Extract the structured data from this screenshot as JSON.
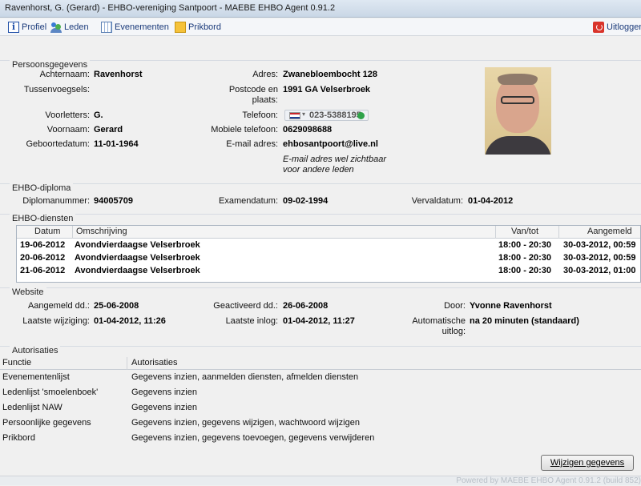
{
  "window": {
    "title": "Ravenhorst, G. (Gerard) - EHBO-vereniging Santpoort - MAEBE EHBO Agent 0.91.2"
  },
  "toolbar": {
    "profiel": "Profiel",
    "leden": "Leden",
    "evenementen": "Evenementen",
    "prikbord": "Prikbord",
    "uitloggen": "Uitloggen"
  },
  "persoon": {
    "legend": "Persoonsgegevens",
    "achternaam_label": "Achternaam:",
    "achternaam": "Ravenhorst",
    "tussenvoegsels_label": "Tussenvoegsels:",
    "tussenvoegsels": "",
    "voorletters_label": "Voorletters:",
    "voorletters": "G.",
    "voornaam_label": "Voornaam:",
    "voornaam": "Gerard",
    "geboortedatum_label": "Geboortedatum:",
    "geboortedatum": "11-01-1964",
    "adres_label": "Adres:",
    "adres": "Zwanebloembocht 128",
    "postcode_label_1": "Postcode en",
    "postcode_label_2": "plaats:",
    "postcode": "1991 GA Velserbroek",
    "telefoon_label": "Telefoon:",
    "telefoon": "023-5388195",
    "mobiel_label": "Mobiele telefoon:",
    "mobiel": "0629098688",
    "email_label": "E-mail adres:",
    "email": "ehbosantpoort@live.nl",
    "email_note_1": "E-mail adres wel zichtbaar",
    "email_note_2": "voor andere leden"
  },
  "diploma": {
    "legend": "EHBO-diploma",
    "nummer_label": "Diplomanummer:",
    "nummer": "94005709",
    "examen_label": "Examendatum:",
    "examen": "09-02-1994",
    "verval_label": "Vervaldatum:",
    "verval": "01-04-2012"
  },
  "diensten": {
    "legend": "EHBO-diensten",
    "columns": [
      "Datum",
      "Omschrijving",
      "Van/tot",
      "Aangemeld"
    ],
    "rows": [
      [
        "19-06-2012",
        "Avondvierdaagse Velserbroek",
        "18:00 - 20:30",
        "30-03-2012, 00:59"
      ],
      [
        "20-06-2012",
        "Avondvierdaagse Velserbroek",
        "18:00 - 20:30",
        "30-03-2012, 00:59"
      ],
      [
        "21-06-2012",
        "Avondvierdaagse Velserbroek",
        "18:00 - 20:30",
        "30-03-2012, 01:00"
      ]
    ]
  },
  "website": {
    "legend": "Website",
    "aangemeld_label": "Aangemeld dd.:",
    "aangemeld": "25-06-2008",
    "geactiveerd_label": "Geactiveerd dd.:",
    "geactiveerd": "26-06-2008",
    "door_label": "Door:",
    "door": "Yvonne Ravenhorst",
    "wijziging_label": "Laatste wijziging:",
    "wijziging": "01-04-2012, 11:26",
    "inlog_label": "Laatste inlog:",
    "inlog": "01-04-2012, 11:27",
    "uitlog_label_1": "Automatische",
    "uitlog_label_2": "uitlog:",
    "uitlog": "na 20 minuten (standaard)"
  },
  "autorisaties": {
    "legend": "Autorisaties",
    "columns": [
      "Functie",
      "Autorisaties"
    ],
    "rows": [
      [
        "Evenementenlijst",
        "Gegevens inzien, aanmelden diensten, afmelden diensten"
      ],
      [
        "Ledenlijst 'smoelenboek'",
        "Gegevens inzien"
      ],
      [
        "Ledenlijst NAW",
        "Gegevens inzien"
      ],
      [
        "Persoonlijke gegevens",
        "Gegevens inzien, gegevens wijzigen, wachtwoord wijzigen"
      ],
      [
        "Prikbord",
        "Gegevens inzien, gegevens toevoegen, gegevens verwijderen"
      ]
    ]
  },
  "actions": {
    "wijzigen": "Wijzigen gegevens"
  },
  "status": {
    "powered": "Powered by MAEBE EHBO Agent 0.91.2 (build 852)"
  },
  "colors": {
    "link": "#1a3a7a",
    "flag_red": "#c8242b",
    "flag_white": "#ffffff",
    "flag_blue": "#1e3f94",
    "ok_green": "#2fa34a"
  }
}
